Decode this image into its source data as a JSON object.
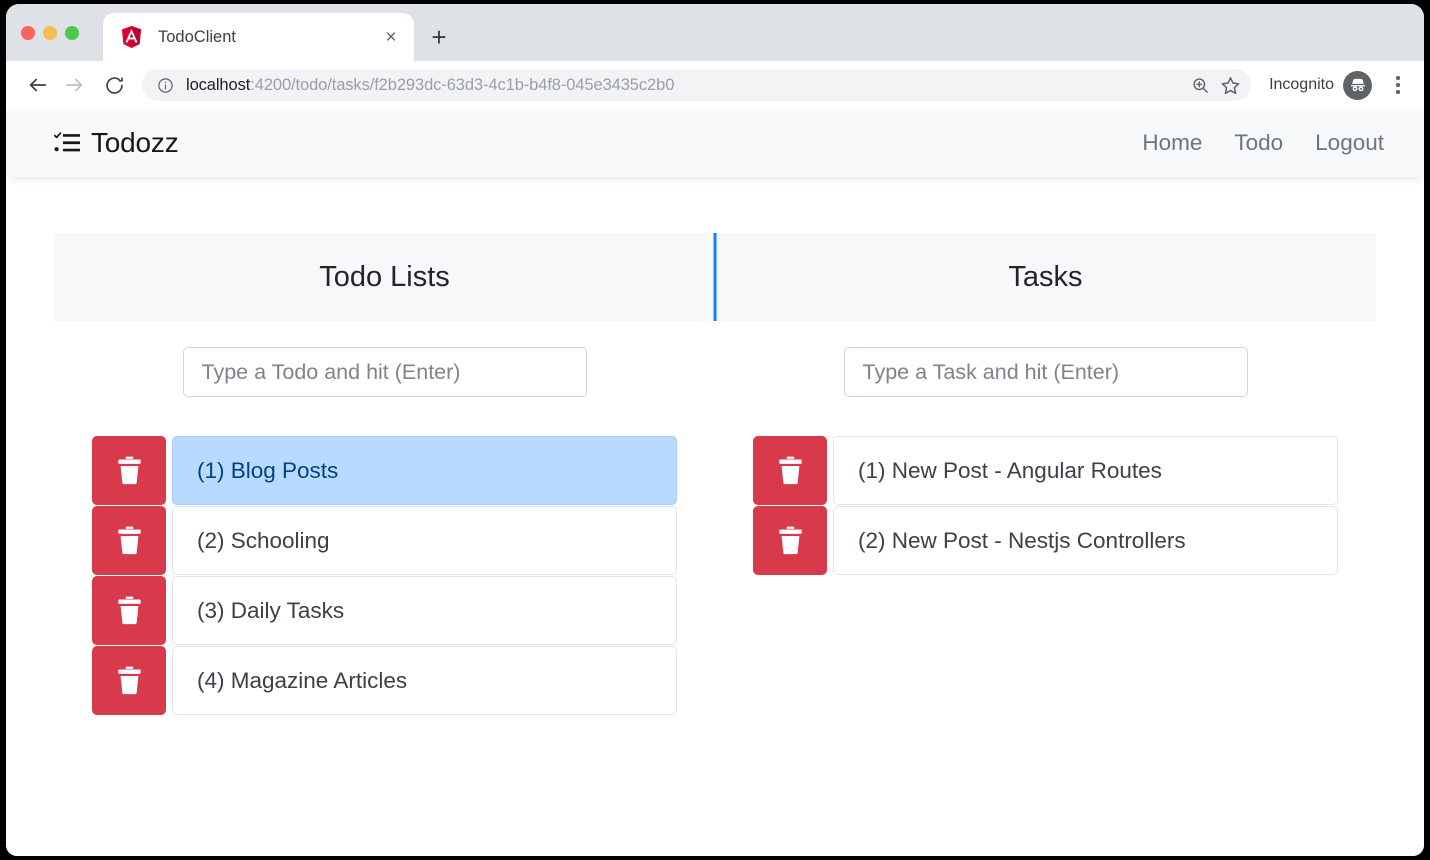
{
  "browser": {
    "tab": {
      "title": "TodoClient",
      "favicon": "angular-logo-icon",
      "close_label": "×"
    },
    "new_tab_label": "+",
    "back_label": "←",
    "forward_label": "→",
    "reload_label": "⟳",
    "omnibox": {
      "site_info_icon": "info-circle-icon",
      "url_host": "localhost",
      "url_path": ":4200/todo/tasks/f2b293dc-63d3-4c1b-b4f8-045e3435c2b0",
      "url_full": "localhost:4200/todo/tasks/f2b293dc-63d3-4c1b-b4f8-045e3435c2b0",
      "zoom_icon": "zoom-in-icon",
      "bookmark_icon": "star-icon"
    },
    "profile": {
      "label": "Incognito",
      "avatar_icon": "incognito-spy-icon"
    },
    "menu_icon": "three-dot-menu-icon",
    "traffic_lights": [
      "close",
      "minimize",
      "maximize"
    ]
  },
  "app": {
    "brand": {
      "icon": "task-list-icon",
      "text": "Todozz"
    },
    "nav_links": [
      {
        "label": "Home"
      },
      {
        "label": "Todo"
      },
      {
        "label": "Logout"
      }
    ]
  },
  "colors": {
    "divider_blue": "#1581fa",
    "danger_red": "#d83a4c",
    "selected_bg": "#b9daff",
    "selected_text": "#004284",
    "panel_head_bg": "#f7f8fa",
    "navbar_bg": "#f8f9fa"
  },
  "panels": {
    "todo": {
      "heading": "Todo Lists",
      "input_placeholder": "Type a Todo and hit (Enter)",
      "input_value": "",
      "delete_icon": "trash-icon",
      "items": [
        {
          "label": "(1) Blog Posts",
          "selected": true
        },
        {
          "label": "(2) Schooling",
          "selected": false
        },
        {
          "label": "(3) Daily Tasks",
          "selected": false
        },
        {
          "label": "(4) Magazine Articles",
          "selected": false
        }
      ]
    },
    "tasks": {
      "heading": "Tasks",
      "input_placeholder": "Type a Task and hit (Enter)",
      "input_value": "",
      "delete_icon": "trash-icon",
      "items": [
        {
          "label": "(1) New Post - Angular Routes",
          "selected": false
        },
        {
          "label": "(2) New Post - Nestjs Controllers",
          "selected": false
        }
      ]
    }
  }
}
